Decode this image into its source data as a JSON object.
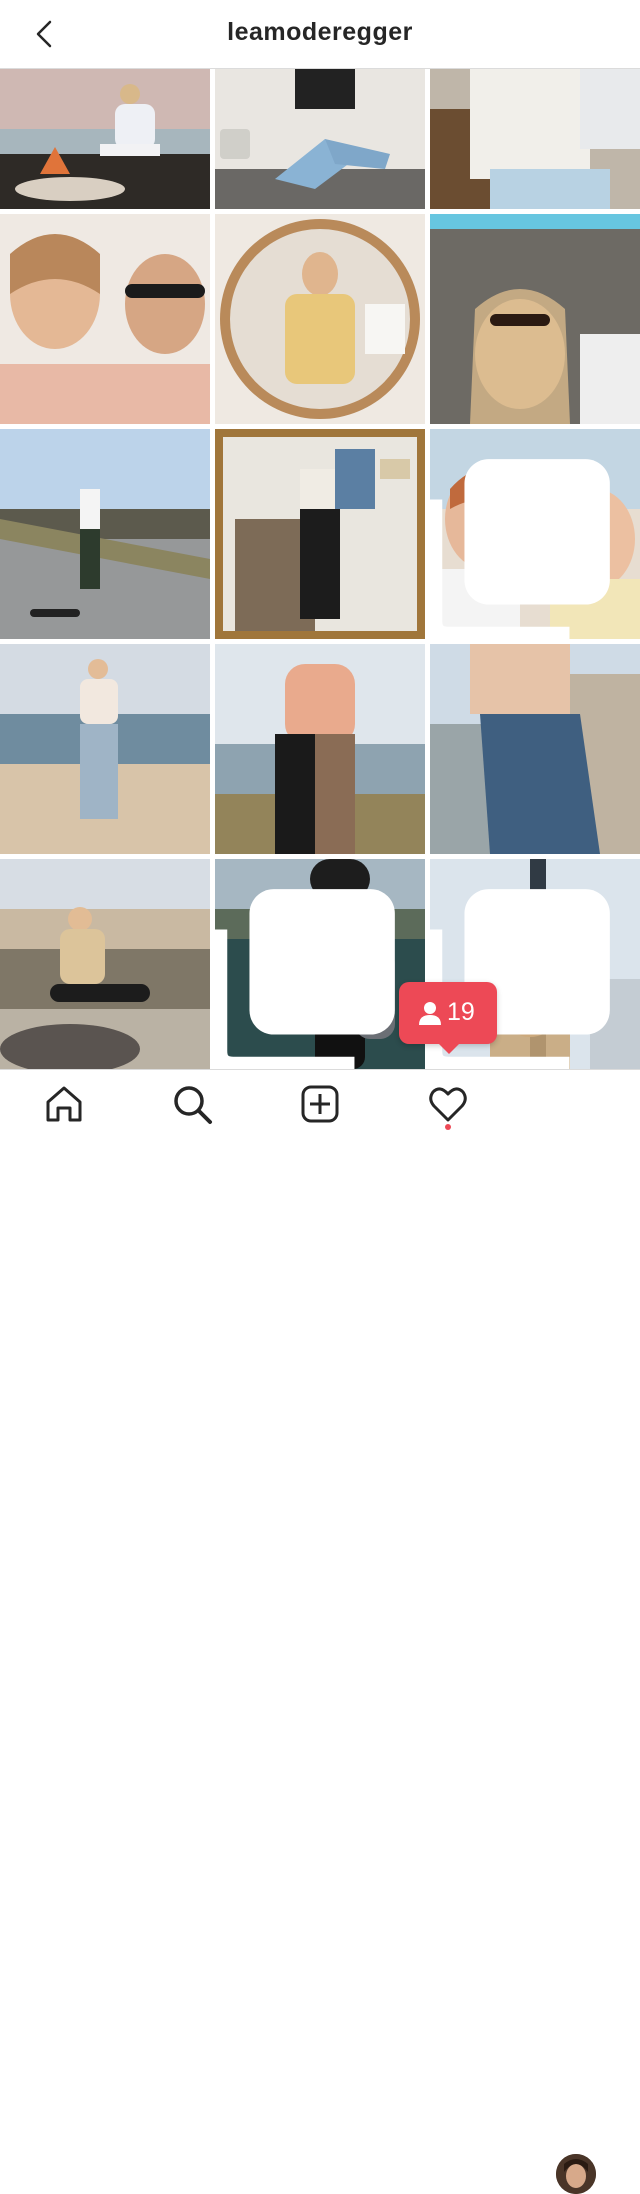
{
  "header": {
    "title": "leamoderegger"
  },
  "badge": {
    "count": "19"
  },
  "colors": {
    "accent": "#ed4956",
    "divider": "#dbdbdb",
    "text": "#262626"
  },
  "tiles": [
    {
      "desc": "campfire-beach"
    },
    {
      "desc": "sitting-floor"
    },
    {
      "desc": "bench-jeans"
    },
    {
      "desc": "couple-selfie"
    },
    {
      "desc": "round-mirror"
    },
    {
      "desc": "wall-selfie"
    },
    {
      "desc": "skateboard-park"
    },
    {
      "desc": "mirror-room"
    },
    {
      "desc": "beach-duo",
      "multi": true
    },
    {
      "desc": "beach-standing"
    },
    {
      "desc": "couple-hug"
    },
    {
      "desc": "jeans-back"
    },
    {
      "desc": "river-sitting"
    },
    {
      "desc": "lake-swimsuit",
      "multi": true
    },
    {
      "desc": "window-portrait",
      "multi": true
    }
  ],
  "tabbar": {
    "items": [
      "home-icon",
      "search-icon",
      "add-post-icon",
      "heart-icon",
      "profile-avatar"
    ]
  }
}
